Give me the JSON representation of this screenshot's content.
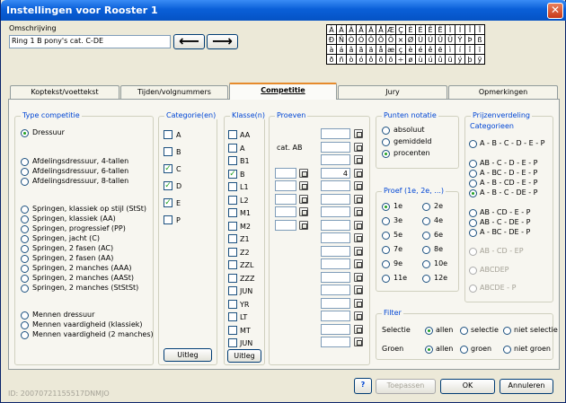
{
  "window": {
    "title": "Instellingen voor Rooster 1"
  },
  "omschrijving": {
    "label": "Omschrijving",
    "value": "Ring 1 B pony's cat. C-DE"
  },
  "chars": [
    [
      "À",
      "Á",
      "Â",
      "Ã",
      "Ä",
      "Å",
      "Æ",
      "Ç",
      "È",
      "É",
      "Ê",
      "Ë",
      "Ì",
      "Í",
      "Î",
      "Ï"
    ],
    [
      "Ð",
      "Ñ",
      "Ò",
      "Ó",
      "Ô",
      "Õ",
      "Ö",
      "×",
      "Ø",
      "Ù",
      "Ú",
      "Û",
      "Ü",
      "Ý",
      "Þ",
      "ß"
    ],
    [
      "à",
      "á",
      "â",
      "ã",
      "ä",
      "å",
      "æ",
      "ç",
      "è",
      "é",
      "ê",
      "ë",
      "ì",
      "í",
      "î",
      "ï"
    ],
    [
      "ð",
      "ñ",
      "ò",
      "ó",
      "ô",
      "õ",
      "ö",
      "÷",
      "ø",
      "ù",
      "ú",
      "û",
      "ü",
      "ý",
      "þ",
      "ÿ"
    ]
  ],
  "tabs": [
    "Koptekst/voettekst",
    "Tijden/volgnummers",
    "Competitie",
    "Jury",
    "Opmerkingen"
  ],
  "type_comp": {
    "title": "Type competitie",
    "items": [
      "Dressuur",
      "Afdelingsdressuur, 4-tallen",
      "Afdelingsdressuur, 6-tallen",
      "Afdelingsdressuur, 8-tallen",
      "Springen, klassiek op stijl (StSt)",
      "Springen, klassiek (AA)",
      "Springen, progressief (PP)",
      "Springen, jacht (C)",
      "Springen, 2 fasen (AC)",
      "Springen, 2 fasen (AA)",
      "Springen, 2 manches (AAA)",
      "Springen, 2 manches (AASt)",
      "Springen, 2 manches (StStSt)",
      "Mennen dressuur",
      "Mennen vaardigheid (klassiek)",
      "Mennen vaardigheid (2 manches)"
    ]
  },
  "categorie": {
    "title": "Categorie(en)",
    "items": [
      "A",
      "B",
      "C",
      "D",
      "E",
      "P"
    ],
    "checked": [
      false,
      false,
      true,
      true,
      true,
      false
    ],
    "button": "Uitleg"
  },
  "klasse": {
    "title": "Klasse(n)",
    "items": [
      "AA",
      "A",
      "B1",
      "B",
      "L1",
      "L2",
      "M1",
      "M2",
      "Z1",
      "Z2",
      "ZZL",
      "ZZZ",
      "JUN",
      "YR",
      "LT",
      "MT",
      "JUN"
    ],
    "checked": [
      false,
      false,
      false,
      true,
      false,
      false,
      false,
      false,
      false,
      false,
      false,
      false,
      false,
      false,
      false,
      false,
      false
    ],
    "button": "Uitleg"
  },
  "proeven": {
    "title": "Proeven",
    "catlabel": "cat. AB",
    "b_value": "4"
  },
  "punten": {
    "title": "Punten notatie",
    "items": [
      "absoluut",
      "gemiddeld",
      "procenten"
    ]
  },
  "proef": {
    "title": "Proef (1e, 2e, ...)",
    "left": [
      "1e",
      "3e",
      "5e",
      "7e",
      "9e",
      "11e"
    ],
    "right": [
      "2e",
      "4e",
      "6e",
      "8e",
      "10e",
      "12e"
    ]
  },
  "prijzen": {
    "title": "Prijzenverdeling",
    "subtitle": "Categorieen",
    "items": [
      "A - B - C - D - E - P",
      "AB - C - D - E - P",
      "A - BC - D - E - P",
      "A - B - CD - E - P",
      "A - B - C - DE - P",
      "AB - CD - E - P",
      "AB - C - DE - P",
      "A - BC - DE - P",
      "AB - CD - EP",
      "ABCDEP",
      "ABCDE - P"
    ]
  },
  "filter": {
    "title": "Filter",
    "selectie_label": "Selectie",
    "groen_label": "Groen",
    "sel": [
      "allen",
      "selectie",
      "niet selectie"
    ],
    "groen": [
      "allen",
      "groen",
      "niet groen"
    ]
  },
  "footer": {
    "id": "ID: 20070721155517DNMJO",
    "toepassen": "Toepassen",
    "ok": "OK",
    "annuleren": "Annuleren"
  }
}
